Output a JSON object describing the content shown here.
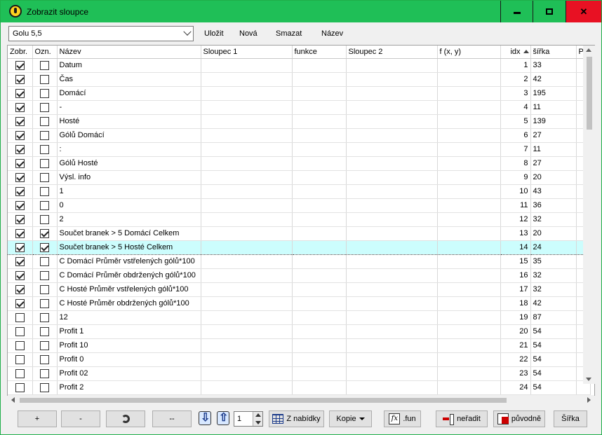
{
  "window": {
    "title": "Zobrazit sloupce",
    "accent_color": "#1fbf57",
    "close_color": "#e81123",
    "icons": {
      "app": "app-icon",
      "minimize": "minimize-icon",
      "maximize": "maximize-icon",
      "close": "close-icon"
    }
  },
  "toolbar": {
    "profile_value": "Golu 5,5",
    "save_label": "Uložit",
    "new_label": "Nová",
    "delete_label": "Smazat",
    "name_label": "Název"
  },
  "grid": {
    "columns": [
      "Zobr.",
      "Ozn.",
      "Název",
      "Sloupec 1",
      "funkce",
      "Sloupec 2",
      "f (x, y)",
      "idx",
      "šířka",
      "Po"
    ],
    "sorted_column": "idx",
    "selected_row_color": "#ccfdfd",
    "rows": [
      {
        "zobr": true,
        "ozn": false,
        "nazev": "Datum",
        "idx": "1",
        "sirka": "33"
      },
      {
        "zobr": true,
        "ozn": false,
        "nazev": "Čas",
        "idx": "2",
        "sirka": "42"
      },
      {
        "zobr": true,
        "ozn": false,
        "nazev": "Domácí",
        "idx": "3",
        "sirka": "195"
      },
      {
        "zobr": true,
        "ozn": false,
        "nazev": "-",
        "idx": "4",
        "sirka": "11"
      },
      {
        "zobr": true,
        "ozn": false,
        "nazev": "Hosté",
        "idx": "5",
        "sirka": "139"
      },
      {
        "zobr": true,
        "ozn": false,
        "nazev": "Gólů Domácí",
        "idx": "6",
        "sirka": "27"
      },
      {
        "zobr": true,
        "ozn": false,
        "nazev": ":",
        "idx": "7",
        "sirka": "11"
      },
      {
        "zobr": true,
        "ozn": false,
        "nazev": "Gólů Hosté",
        "idx": "8",
        "sirka": "27"
      },
      {
        "zobr": true,
        "ozn": false,
        "nazev": "Výsl. info",
        "idx": "9",
        "sirka": "20"
      },
      {
        "zobr": true,
        "ozn": false,
        "nazev": "1",
        "idx": "10",
        "sirka": "43"
      },
      {
        "zobr": true,
        "ozn": false,
        "nazev": "0",
        "idx": "11",
        "sirka": "36"
      },
      {
        "zobr": true,
        "ozn": false,
        "nazev": "2",
        "idx": "12",
        "sirka": "32"
      },
      {
        "zobr": true,
        "ozn": true,
        "nazev": "Součet branek > 5 Domácí Celkem",
        "idx": "13",
        "sirka": "20"
      },
      {
        "zobr": true,
        "ozn": true,
        "nazev": "Součet branek > 5 Hosté Celkem",
        "idx": "14",
        "sirka": "24",
        "selected": true
      },
      {
        "zobr": true,
        "ozn": false,
        "nazev": "C Domácí Průměr vstřelených gólů*100",
        "idx": "15",
        "sirka": "35"
      },
      {
        "zobr": true,
        "ozn": false,
        "nazev": "C Domácí Průměr obdržených gólů*100",
        "idx": "16",
        "sirka": "32"
      },
      {
        "zobr": true,
        "ozn": false,
        "nazev": "C Hosté Průměr vstřelených gólů*100",
        "idx": "17",
        "sirka": "32"
      },
      {
        "zobr": true,
        "ozn": false,
        "nazev": "C Hosté Průměr obdržených gólů*100",
        "idx": "18",
        "sirka": "42"
      },
      {
        "zobr": false,
        "ozn": false,
        "nazev": "12",
        "idx": "19",
        "sirka": "87"
      },
      {
        "zobr": false,
        "ozn": false,
        "nazev": "Profit 1",
        "idx": "20",
        "sirka": "54"
      },
      {
        "zobr": false,
        "ozn": false,
        "nazev": "Profit 10",
        "idx": "21",
        "sirka": "54"
      },
      {
        "zobr": false,
        "ozn": false,
        "nazev": "Profit 0",
        "idx": "22",
        "sirka": "54"
      },
      {
        "zobr": false,
        "ozn": false,
        "nazev": "Profit 02",
        "idx": "23",
        "sirka": "54"
      },
      {
        "zobr": false,
        "ozn": false,
        "nazev": "Profit 2",
        "idx": "24",
        "sirka": "54"
      }
    ]
  },
  "bottom": {
    "add_label": "+",
    "remove_label": "-",
    "clear_label": "--",
    "step_value": "1",
    "from_menu_label": "Z nabídky",
    "copy_label": "Kopie",
    "fun_label": ".fun",
    "unsort_label": "neřadit",
    "original_label": "původně",
    "width_label": "Šířka"
  }
}
